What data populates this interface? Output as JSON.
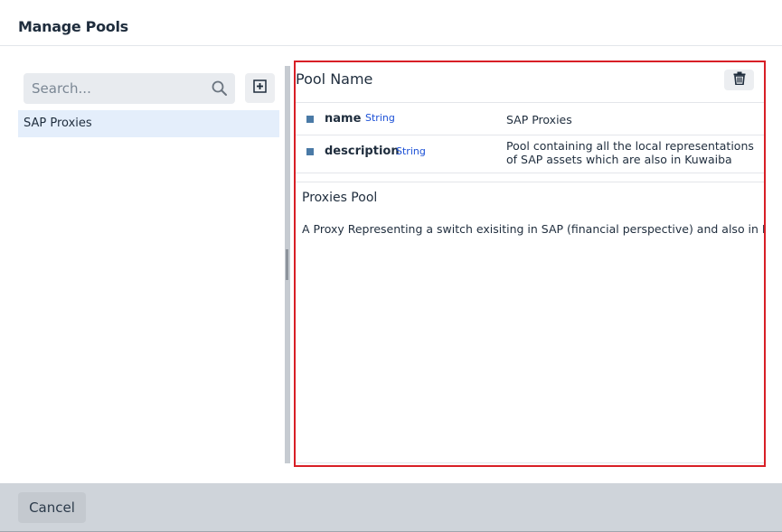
{
  "dialog": {
    "title": "Manage Pools"
  },
  "search": {
    "placeholder": "Search...",
    "value": ""
  },
  "pools": [
    {
      "label": "SAP Proxies",
      "selected": true
    }
  ],
  "details": {
    "header_label": "Pool Name",
    "properties": [
      {
        "name": "name",
        "type": "String",
        "value_lines": [
          "SAP Proxies"
        ]
      },
      {
        "name": "description",
        "type": "String",
        "value_lines": [
          "Pool containing all the local representations",
          "of SAP assets which are also in Kuwaiba"
        ]
      }
    ],
    "pool_title": "Proxies Pool",
    "pool_description": "A Proxy Representing a switch exisiting in SAP (financial perspective) and also in Kuwaiba"
  },
  "footer": {
    "cancel_label": "Cancel"
  },
  "colors": {
    "highlight_border": "#d81f26",
    "selected_item_bg": "#e4eefb",
    "type_text": "#1a4fd6",
    "marker": "#4a7aa6",
    "footer_bg": "#cfd4da"
  },
  "icons": {
    "search": "search-icon",
    "add": "plus-square-icon",
    "delete": "trash-icon",
    "property_marker": "square-bullet-icon"
  }
}
